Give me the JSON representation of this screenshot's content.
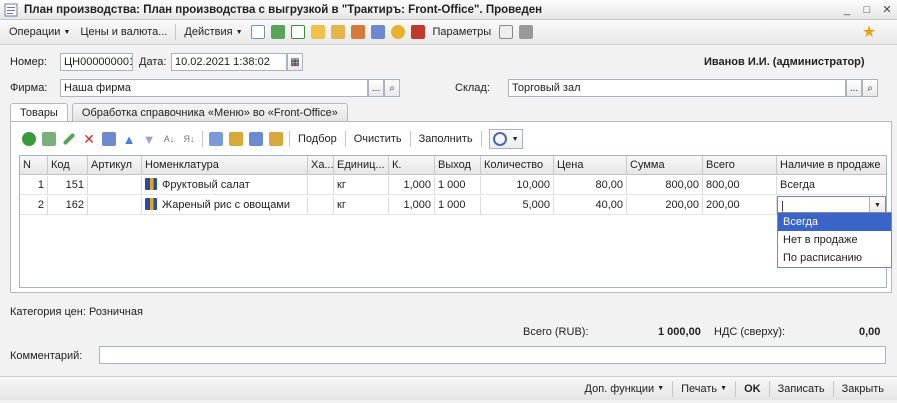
{
  "window": {
    "title": "План производства: План производства с выгрузкой в \"Трактиръ: Front-Office\". Проведен"
  },
  "menubar": {
    "operations": "Операции",
    "prices": "Цены и валюта...",
    "actions": "Действия",
    "params": "Параметры"
  },
  "header": {
    "number_label": "Номер:",
    "number_value": "ЦН000000001",
    "date_label": "Дата:",
    "date_value": "10.02.2021  1:38:02",
    "user": "Иванов И.И. (администратор)",
    "firm_label": "Фирма:",
    "firm_value": "Наша фирма",
    "warehouse_label": "Склад:",
    "warehouse_value": "Торговый зал"
  },
  "tabs": [
    "Товары",
    "Обработка справочника «Меню» во «Front-Office»"
  ],
  "table_toolbar": {
    "select": "Подбор",
    "clear": "Очистить",
    "fill": "Заполнить"
  },
  "table": {
    "columns": [
      "N",
      "Код",
      "Артикул",
      "Номенклатура",
      "Ха...",
      "Единиц...",
      "К.",
      "Выход",
      "Количество",
      "Цена",
      "Сумма",
      "Всего",
      "Наличие в продаже"
    ],
    "rows": [
      {
        "n": "1",
        "code": "151",
        "article": "",
        "name": "Фруктовый салат",
        "char": "",
        "unit": "кг",
        "k": "1,000",
        "out": "1 000",
        "qty": "10,000",
        "price": "80,00",
        "sum": "800,00",
        "total": "800,00",
        "avail": "Всегда"
      },
      {
        "n": "2",
        "code": "162",
        "article": "",
        "name": "Жареный рис с овощами",
        "char": "",
        "unit": "кг",
        "k": "1,000",
        "out": "1 000",
        "qty": "5,000",
        "price": "40,00",
        "sum": "200,00",
        "total": "200,00",
        "avail": ""
      }
    ]
  },
  "dropdown": {
    "options": [
      "Всегда",
      "Нет в продаже",
      "По расписанию"
    ],
    "selected": "Всегда"
  },
  "footer": {
    "price_category": "Категория цен: Розничная",
    "total_label": "Всего (RUB):",
    "total_value": "1 000,00",
    "vat_label": "НДС (сверху):",
    "vat_value": "0,00",
    "comment_label": "Комментарий:",
    "comment_value": ""
  },
  "bottombar": {
    "extra": "Доп. функции",
    "print": "Печать",
    "ok": "OK",
    "save": "Записать",
    "close": "Закрыть"
  },
  "colors": {
    "selection": "#3a64c8",
    "accent_star": "#e8a21b"
  }
}
